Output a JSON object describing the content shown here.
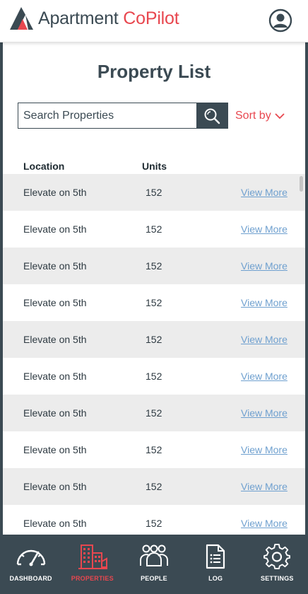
{
  "header": {
    "brand_part1": "Apartment ",
    "brand_part2": "CoPilot",
    "user_icon": "user-circle-icon"
  },
  "page_title": "Property List",
  "search": {
    "placeholder": "Search Properties",
    "value": ""
  },
  "sort": {
    "label": "Sort by"
  },
  "table": {
    "headers": {
      "location": "Location",
      "units": "Units"
    },
    "rows": [
      {
        "location": "Elevate on 5th",
        "units": "152",
        "link": "View More"
      },
      {
        "location": "Elevate on 5th",
        "units": "152",
        "link": "View More"
      },
      {
        "location": "Elevate on 5th",
        "units": "152",
        "link": "View More"
      },
      {
        "location": "Elevate on 5th",
        "units": "152",
        "link": "View More"
      },
      {
        "location": "Elevate on 5th",
        "units": "152",
        "link": "View More"
      },
      {
        "location": "Elevate on 5th",
        "units": "152",
        "link": "View More"
      },
      {
        "location": "Elevate on 5th",
        "units": "152",
        "link": "View More"
      },
      {
        "location": "Elevate on 5th",
        "units": "152",
        "link": "View More"
      },
      {
        "location": "Elevate on 5th",
        "units": "152",
        "link": "View More"
      },
      {
        "location": "Elevate on 5th",
        "units": "152",
        "link": "View More"
      }
    ]
  },
  "tabs": [
    {
      "label": "DASHBOARD",
      "icon": "speedometer-icon",
      "active": false
    },
    {
      "label": "PROPERTIES",
      "icon": "buildings-icon",
      "active": true
    },
    {
      "label": "PEOPLE",
      "icon": "people-icon",
      "active": false
    },
    {
      "label": "LOG",
      "icon": "document-list-icon",
      "active": false
    },
    {
      "label": "SETTINGS",
      "icon": "gear-icon",
      "active": false
    }
  ],
  "colors": {
    "brand_dark": "#3b4a53",
    "accent_red": "#e8474f",
    "link_blue": "#6fa0cf",
    "row_alt": "#ececec"
  }
}
